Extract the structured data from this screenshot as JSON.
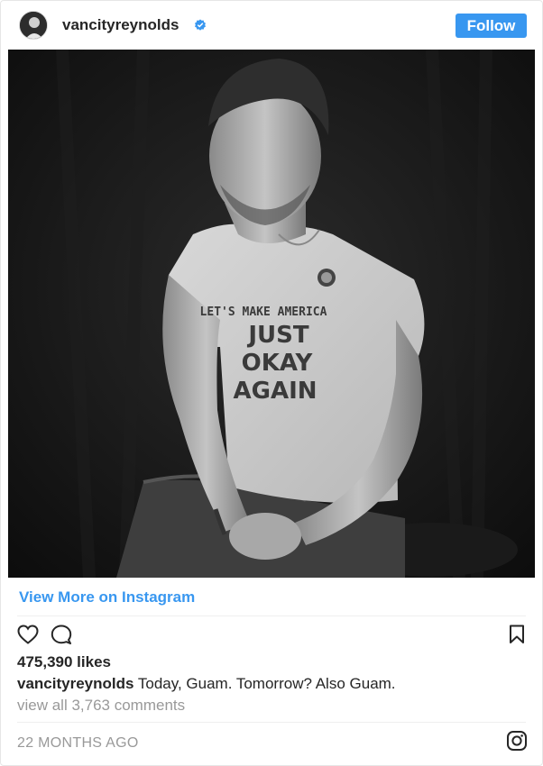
{
  "post": {
    "username": "vancityreynolds",
    "verified": true,
    "follow_label": "Follow",
    "photo_shirt_lines": [
      "LET'S MAKE AMERICA",
      "JUST",
      "OKAY",
      "AGAIN"
    ],
    "view_more_label": "View More on Instagram",
    "likes": "475,390 likes",
    "caption_user": "vancityreynolds",
    "caption_text": "Today, Guam. Tomorrow? Also Guam.",
    "comments_link": "view all 3,763 comments",
    "timestamp": "22 MONTHS AGO"
  },
  "icons": {
    "verified": "verified-badge-icon",
    "like": "heart-icon",
    "comment": "comment-bubble-icon",
    "save": "bookmark-icon",
    "logo": "instagram-logo-icon"
  },
  "colors": {
    "accent": "#3897f0",
    "text": "#262626",
    "muted": "#999999"
  }
}
